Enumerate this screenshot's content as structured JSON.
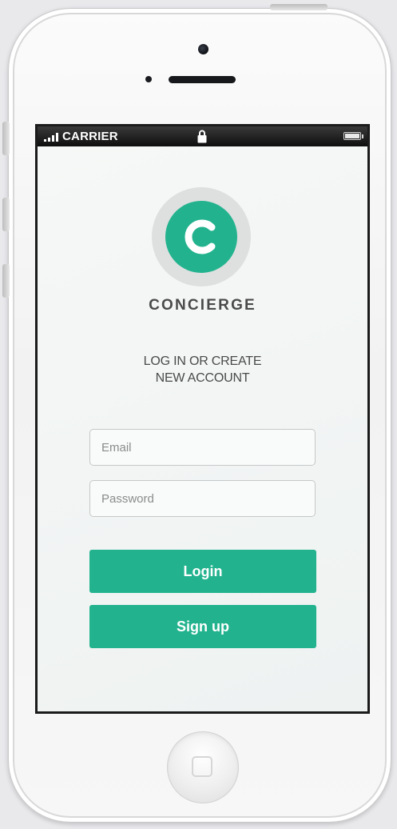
{
  "status_bar": {
    "carrier": "CARRIER",
    "signal_icon": "signal-bars-icon",
    "lock_icon": "lock-icon",
    "battery_icon": "battery-icon"
  },
  "app": {
    "logo_letter": "C",
    "name": "CONCIERGE",
    "headline_line1": "LOG IN OR CREATE",
    "headline_line2": "NEW ACCOUNT",
    "accent_color": "#22b38e"
  },
  "form": {
    "email": {
      "value": "",
      "placeholder": "Email"
    },
    "password": {
      "value": "",
      "placeholder": "Password"
    },
    "login_label": "Login",
    "signup_label": "Sign up"
  },
  "device": {
    "home_icon": "home-button-icon",
    "camera_icon": "front-camera-icon",
    "speaker_icon": "earpiece-speaker-icon"
  }
}
